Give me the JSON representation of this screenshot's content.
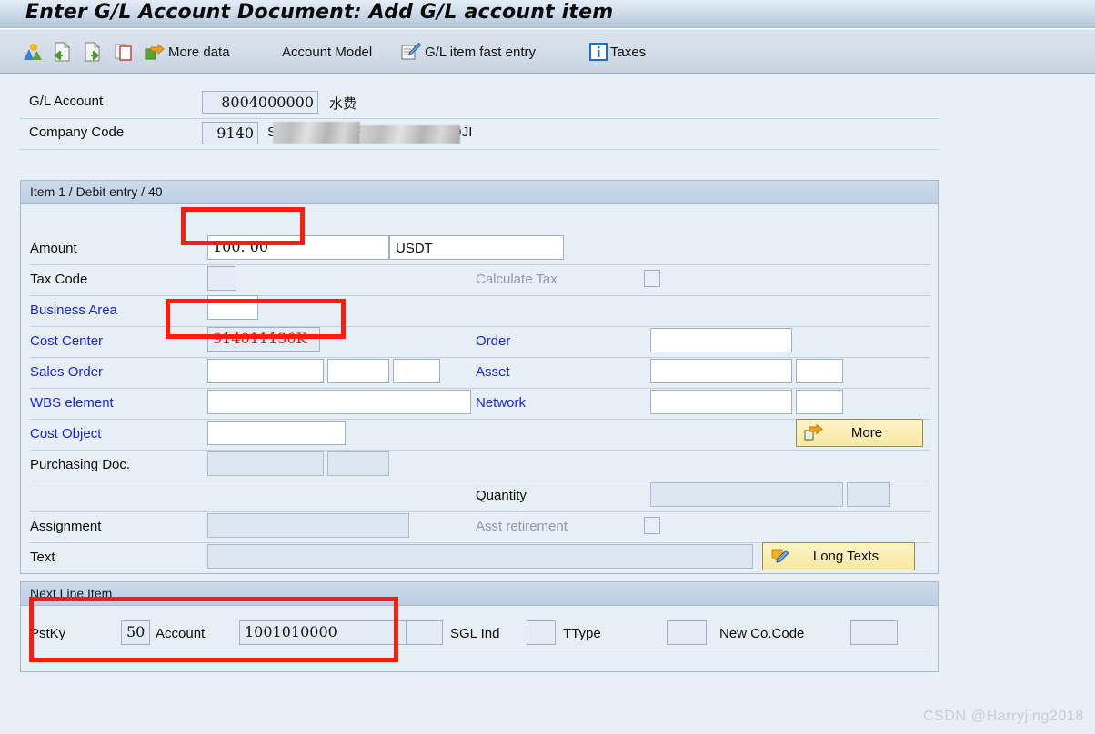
{
  "window": {
    "title": "Enter G/L Account Document: Add G/L account item"
  },
  "toolbar": {
    "items": [
      {
        "name": "picture-icon",
        "label": ""
      },
      {
        "name": "prev-document-icon",
        "label": ""
      },
      {
        "name": "next-document-icon",
        "label": ""
      },
      {
        "name": "copy-icon",
        "label": ""
      },
      {
        "name": "more-data-icon",
        "label": "More data"
      },
      {
        "name": "account-model",
        "label": "Account Model"
      },
      {
        "name": "gl-fast-entry-icon",
        "label": "G/L item fast entry"
      },
      {
        "name": "taxes-info-icon",
        "label": "Taxes"
      }
    ],
    "more_data_label": "More data",
    "account_model_label": "Account Model",
    "gl_fast_entry_label": "G/L item fast entry",
    "taxes_label": "Taxes"
  },
  "header": {
    "gl_account_label": "G/L Account",
    "gl_account_value": "8004000000",
    "gl_account_desc": "水费",
    "company_code_label": "Company Code",
    "company_code_value": "9140",
    "company_code_desc_prefix": "SAL",
    "company_code_desc_suffix": "OJI",
    "company_code_desc_masked": "SAL■■■■■ TURKEY TEKNOLOJI"
  },
  "item_panel": {
    "header": "Item 1 / Debit entry / 40",
    "amount_label": "Amount",
    "amount_value": "100. 00",
    "currency": "USDT",
    "tax_code_label": "Tax Code",
    "tax_code_value": "",
    "calculate_tax_label": "Calculate Tax",
    "calculate_tax_checked": false,
    "business_area_label": "Business Area",
    "business_area_value": "",
    "cost_center_label": "Cost Center",
    "cost_center_value": "914011130K",
    "order_label": "Order",
    "order_value": "",
    "sales_order_label": "Sales Order",
    "sales_order_value": "",
    "sales_order_item": "",
    "sales_order_sched": "",
    "asset_label": "Asset",
    "asset_value": "",
    "asset_sub": "",
    "wbs_element_label": "WBS element",
    "wbs_element_value": "",
    "network_label": "Network",
    "network_value": "",
    "network_sub": "",
    "cost_object_label": "Cost Object",
    "cost_object_value": "",
    "more_button_label": "More",
    "purchasing_doc_label": "Purchasing Doc.",
    "purchasing_doc_value": "",
    "purchasing_doc_item": "",
    "quantity_label": "Quantity",
    "quantity_value": "",
    "quantity_unit": "",
    "assignment_label": "Assignment",
    "assignment_value": "",
    "asst_retirement_label": "Asst retirement",
    "asst_retirement_checked": false,
    "text_label": "Text",
    "text_value": "",
    "long_texts_button_label": "Long Texts"
  },
  "next_line_item": {
    "header": "Next Line Item",
    "pstky_label": "PstKy",
    "pstky_value": "50",
    "account_label": "Account",
    "account_value": "1001010000",
    "account_sub_value": "",
    "sgl_ind_label": "SGL Ind",
    "sgl_ind_value": "",
    "ttype_label": "TType",
    "ttype_value": "",
    "new_cocode_label": "New Co.Code",
    "new_cocode_value": ""
  },
  "annotations": {
    "color": "#fe1d0b",
    "boxes": [
      "amount-field",
      "cost-center-field",
      "next-line-item-row"
    ]
  },
  "watermark": "CSDN @Harryjing2018"
}
